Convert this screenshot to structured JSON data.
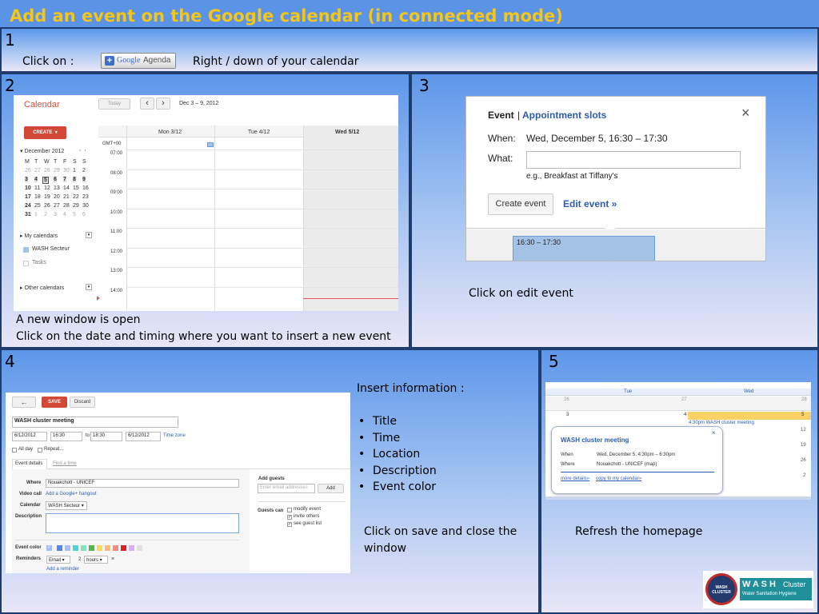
{
  "title": "Add an event on the Google calendar (in connected mode)",
  "panel1": {
    "num": "1",
    "click_on": "Click on :",
    "button_label": "Agenda",
    "button_google": "Google",
    "location_text": "Right / down of your calendar"
  },
  "panel2": {
    "num": "2",
    "app_name": "Calendar",
    "today": "Today",
    "date_range": "Dec 3 – 9, 2012",
    "create": "CREATE",
    "days": [
      "Mon 3/12",
      "Tue 4/12",
      "Wed 5/12"
    ],
    "gmt": "GMT+00",
    "times": [
      "07:00",
      "08:00",
      "09:00",
      "10:00",
      "11:00",
      "12:00",
      "13:00",
      "14:00"
    ],
    "mini_month": "December 2012",
    "mini_days_header": [
      "M",
      "T",
      "W",
      "T",
      "F",
      "S",
      "S"
    ],
    "mini_weeks": [
      [
        "26",
        "27",
        "28",
        "29",
        "30",
        "1",
        "2"
      ],
      [
        "3",
        "4",
        "5",
        "6",
        "7",
        "8",
        "9"
      ],
      [
        "10",
        "11",
        "12",
        "13",
        "14",
        "15",
        "16"
      ],
      [
        "17",
        "18",
        "19",
        "20",
        "21",
        "22",
        "23"
      ],
      [
        "24",
        "25",
        "26",
        "27",
        "28",
        "29",
        "30"
      ],
      [
        "31",
        "1",
        "2",
        "3",
        "4",
        "5",
        "6"
      ]
    ],
    "my_calendars": "My calendars",
    "calendar_items": [
      "WASH Secteur",
      "Tasks"
    ],
    "other_calendars": "Other calendars",
    "caption_line1": "A new window is open",
    "caption_line2": "Click on the date and timing where you want to insert a new event"
  },
  "panel3": {
    "num": "3",
    "tab_event": "Event",
    "tab_sep": "|",
    "tab_appointments": "Appointment slots",
    "close": "×",
    "when_label": "When:",
    "when_value": "Wed, December 5, 16:30 – 17:30",
    "what_label": "What:",
    "what_hint": "e.g., Breakfast at Tiffany's",
    "create_event": "Create event",
    "edit_event": "Edit event »",
    "slot": "16:30 – 17:30",
    "caption": "Click on edit event"
  },
  "panel4": {
    "num": "4",
    "back": "←",
    "save": "SAVE",
    "discard": "Discard",
    "event_title": "WASH cluster meeting",
    "start_date": "6/12/2012",
    "start_time": "16:30",
    "to": "to",
    "end_time": "18:30",
    "end_date": "6/12/2012",
    "time_zone": "Time zone",
    "all_day": "All day",
    "repeat": "Repeat...",
    "tab_details": "Event details",
    "tab_find_time": "Find a time",
    "where_label": "Where",
    "where_value": "Nouakchott - UNICEF",
    "video_label": "Video call",
    "video_link": "Add a Google+ hangout",
    "calendar_label": "Calendar",
    "calendar_value": "WASH Secteur",
    "description_label": "Description",
    "color_label": "Event color",
    "reminders_label": "Reminders",
    "reminder_type": "Email",
    "reminder_value": "2",
    "reminder_unit": "hours",
    "reminder_remove": "×",
    "add_reminder": "Add a reminder",
    "add_guests": "Add guests",
    "guest_placeholder": "Enter email addresses",
    "add": "Add",
    "guests_can": "Guests can",
    "perms": [
      "modify event",
      "invite others",
      "see guest list"
    ],
    "insert_info": "Insert information :",
    "bullets": [
      "Title",
      "Time",
      "Location",
      "Description",
      "Event color"
    ],
    "caption_line1": "Click on save and close the",
    "caption_line2": "window",
    "colors": [
      "#5484ed",
      "#a4bdfc",
      "#46d6db",
      "#7ae7bf",
      "#51b749",
      "#fbd75b",
      "#ffb878",
      "#ff887c",
      "#dc2127",
      "#dbadff",
      "#e1e1e1"
    ]
  },
  "panel5": {
    "num": "5",
    "col_tue": "Tue",
    "col_wed": "Wed",
    "row1": [
      "26",
      "27",
      "28"
    ],
    "row2": [
      "3",
      "4",
      "5"
    ],
    "side_nums": [
      "12",
      "19",
      "26",
      "2"
    ],
    "chip": "4:30pm WASH cluster meeting",
    "popup_title": "WASH cluster meeting",
    "popup_close": "×",
    "when_label": "When",
    "when_value": "Wed, December 5, 4:30pm – 6:30pm",
    "where_label": "Where",
    "where_value": "Nouakchott - UNICEF (map)",
    "more_details": "more details»",
    "copy_link": "copy to my calendar»",
    "caption": "Refresh the homepage"
  },
  "logo": {
    "circle_text": "WASH CLUSTER",
    "name": "W A S H",
    "cluster": "Cluster",
    "tagline": "Water Sanitation Hygiene"
  }
}
